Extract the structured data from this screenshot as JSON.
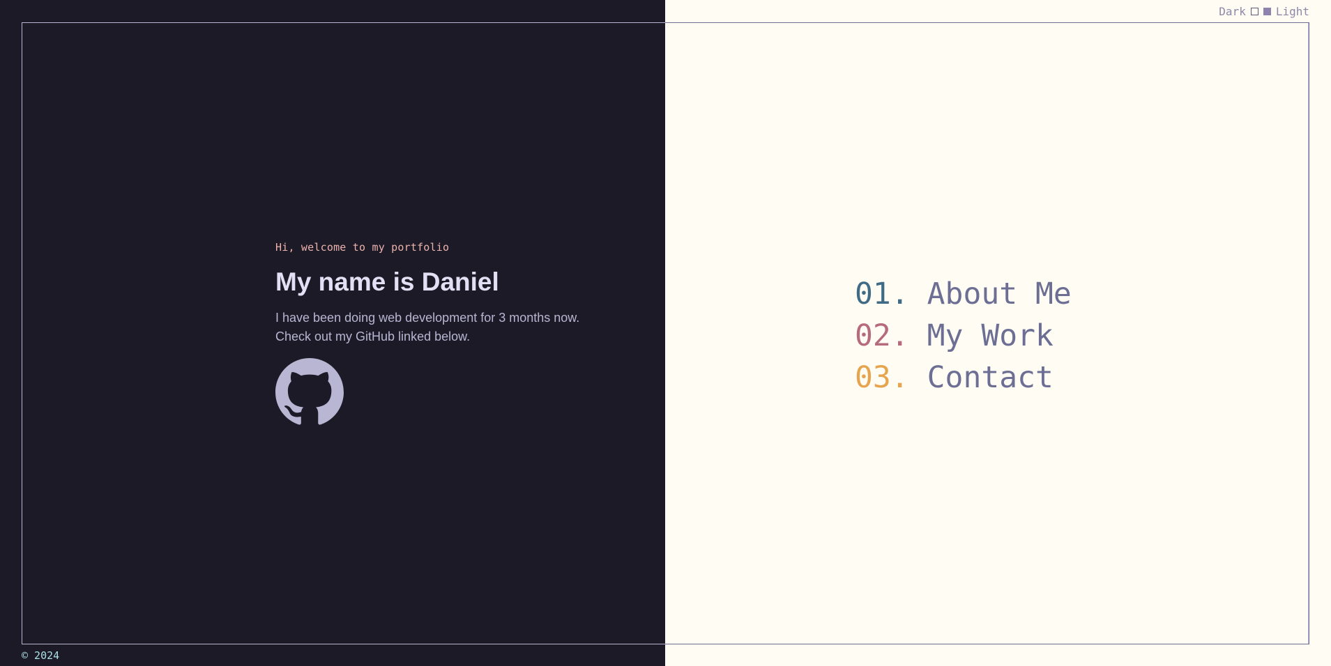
{
  "theme_toggle": {
    "dark_label": "Dark",
    "light_label": "Light"
  },
  "hero": {
    "greeting": "Hi, welcome to my portfolio",
    "title": "My name is Daniel",
    "bio_line1": "I have been doing web development for 3 months now.",
    "bio_line2": "Check out my GitHub linked below.",
    "github_icon": "github-icon"
  },
  "nav": {
    "items": [
      {
        "number": "01.",
        "label": "About Me",
        "color": "#3f6b86"
      },
      {
        "number": "02.",
        "label": "My Work",
        "color": "#b56b7b"
      },
      {
        "number": "03.",
        "label": "Contact",
        "color": "#e5a44d"
      }
    ]
  },
  "footer": {
    "copyright": "© 2024"
  },
  "colors": {
    "dark_bg": "#1c1a26",
    "light_bg": "#fffcf4",
    "accent": "#8f82ac"
  }
}
